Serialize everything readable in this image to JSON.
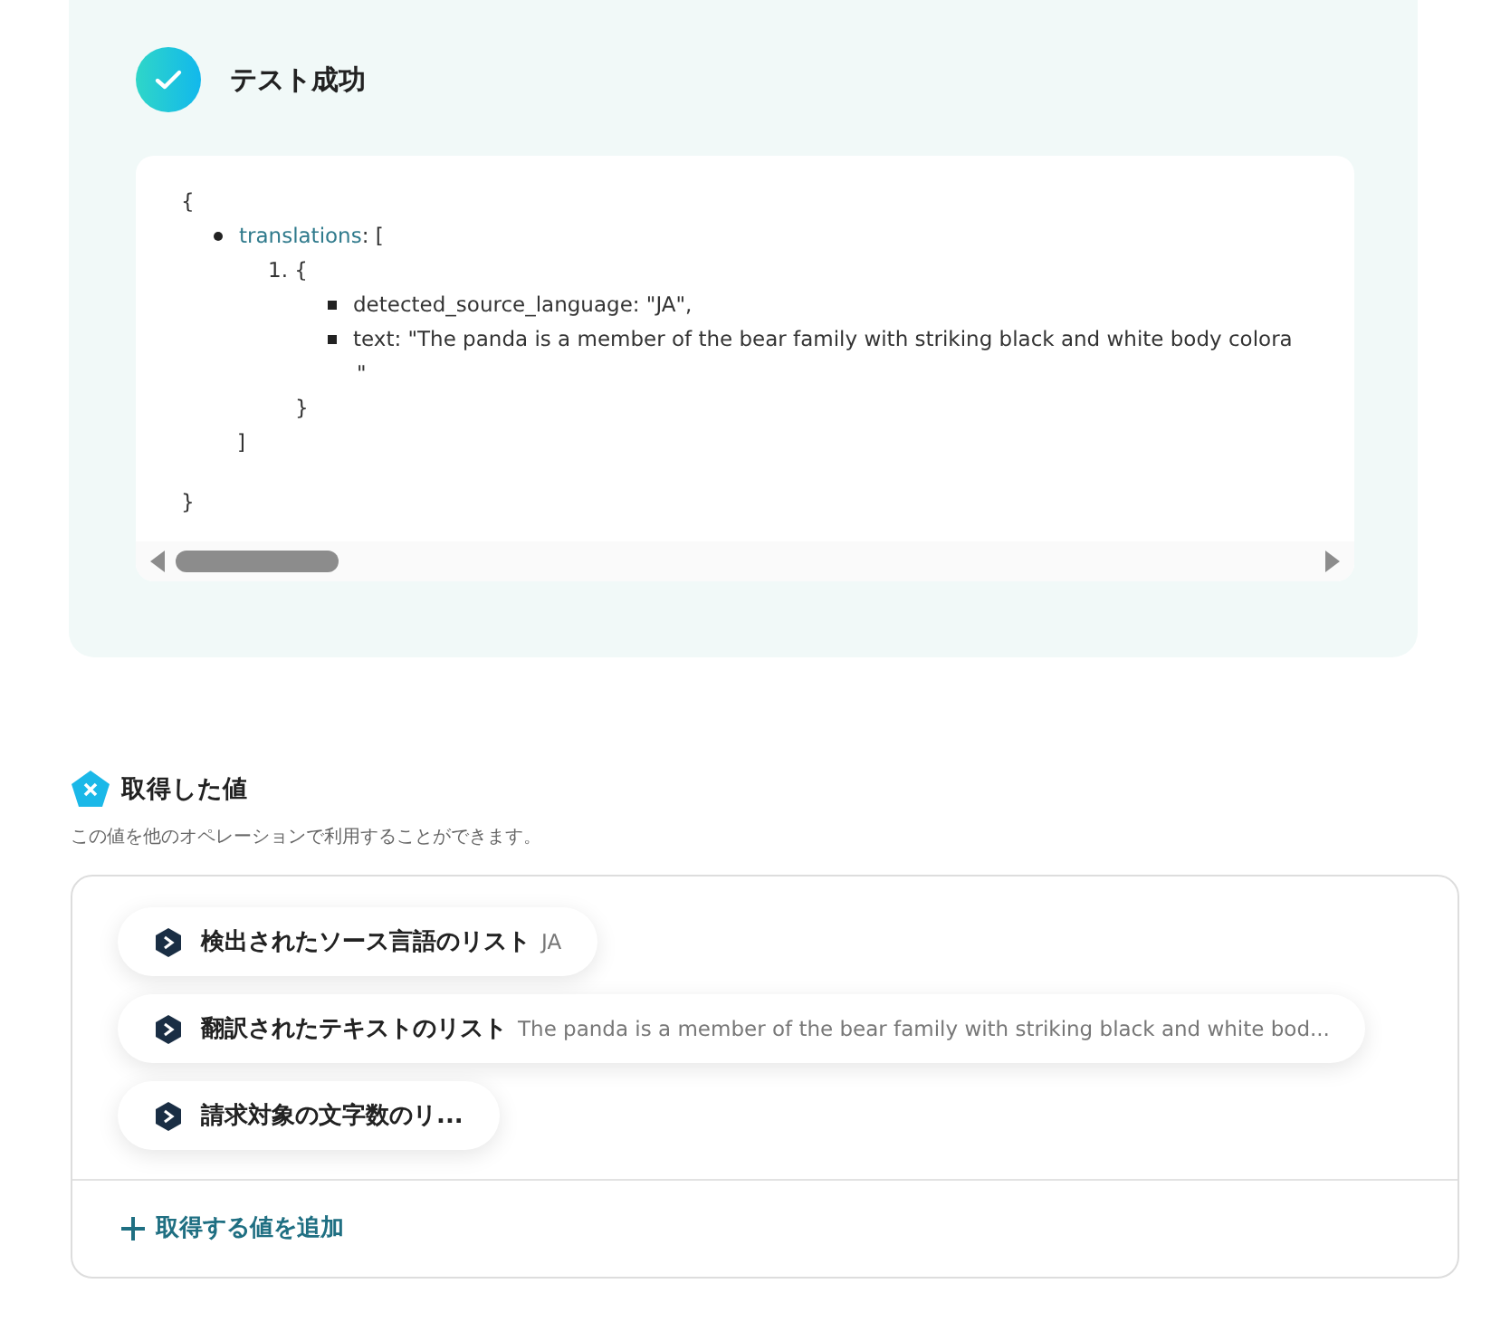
{
  "result": {
    "title": "テスト成功",
    "code": {
      "open": "{",
      "close": "}",
      "items": [
        {
          "key": "translations",
          "suffix": ": [",
          "close": "]",
          "children": [
            {
              "number": "1.",
              "open": "{",
              "close": "}",
              "fields": [
                {
                  "text": "detected_source_language: \"JA\","
                },
                {
                  "text": "text: \"The panda is a member of the bear family with striking black and white body colora",
                  "continuation": "\""
                }
              ]
            }
          ]
        }
      ]
    }
  },
  "values": {
    "title": "取得した値",
    "description": "この値を他のオペレーションで利用することができます。",
    "chips": [
      {
        "label": "検出されたソース言語のリスト",
        "value": "JA"
      },
      {
        "label": "翻訳されたテキストのリスト",
        "value": "The panda is a member of the bear family with striking black and white bod..."
      },
      {
        "label": "請求対象の文字数のリ..."
      }
    ],
    "add_button": "取得する値を追加"
  }
}
